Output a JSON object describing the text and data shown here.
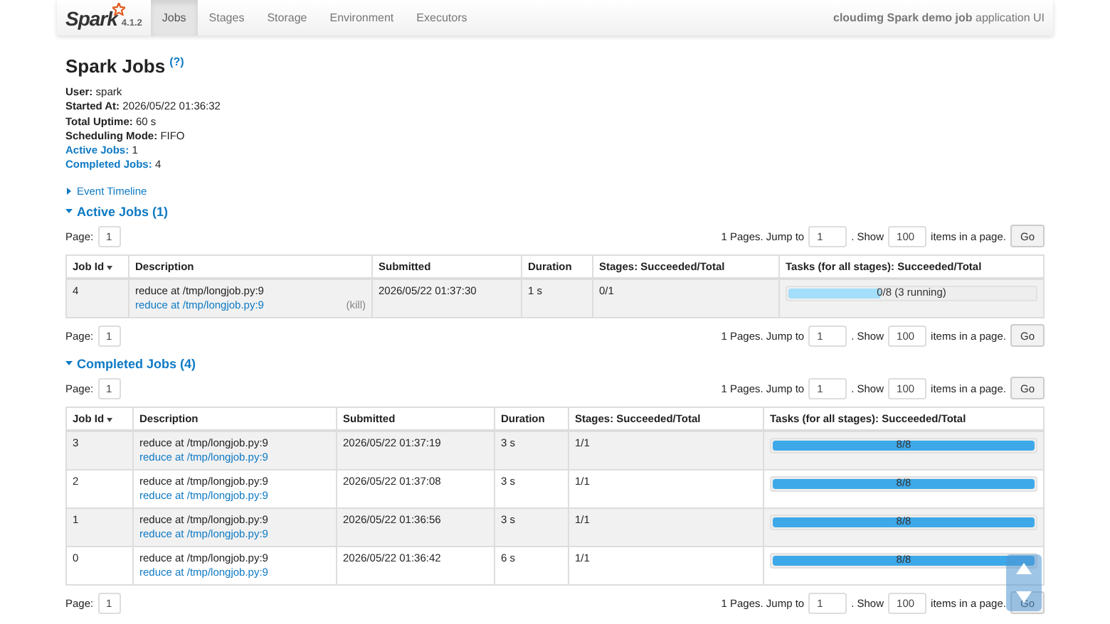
{
  "navbar": {
    "logo_text": "Spark",
    "version": "4.1.2",
    "tabs": [
      {
        "label": "Jobs",
        "selected": true
      },
      {
        "label": "Stages",
        "selected": false
      },
      {
        "label": "Storage",
        "selected": false
      },
      {
        "label": "Environment",
        "selected": false
      },
      {
        "label": "Executors",
        "selected": false
      }
    ],
    "app_title": "**cloudimg Spark demo job** application UI"
  },
  "title": "Spark Jobs",
  "help": "(?)",
  "summary": [
    {
      "label": "User:",
      "value": "spark",
      "link": false
    },
    {
      "label": "Started At:",
      "value": "2026/05/22 01:36:32",
      "link": false
    },
    {
      "label": "Total Uptime:",
      "value": "60 s",
      "link": false
    },
    {
      "label": "Scheduling Mode:",
      "value": "FIFO",
      "link": false
    },
    {
      "label": "Active Jobs:",
      "value": "1",
      "link": true
    },
    {
      "label": "Completed Jobs:",
      "value": "4",
      "link": true
    }
  ],
  "event_timeline": {
    "label": "Event Timeline",
    "expanded": false
  },
  "sections": [
    {
      "title": "Active Jobs (1)",
      "expanded": true,
      "pagers": [
        {
          "page_label": "Page:",
          "page": "1",
          "pages_text": "1 Pages. Jump to",
          "jump": "1",
          "show_label": ". Show",
          "show": "100",
          "items_label": "items in a page.",
          "go": "Go"
        },
        {
          "page_label": "Page:",
          "page": "1",
          "pages_text": "1 Pages. Jump to",
          "jump": "1",
          "show_label": ". Show",
          "show": "100",
          "items_label": "items in a page.",
          "go": "Go"
        }
      ],
      "columns": [
        {
          "label": "Job Id",
          "sorted": true
        },
        {
          "label": "Description",
          "sorted": false
        },
        {
          "label": "Submitted",
          "sorted": false
        },
        {
          "label": "Duration",
          "sorted": false
        },
        {
          "label": "Stages: Succeeded/Total",
          "sorted": false
        },
        {
          "label": "Tasks (for all stages): Succeeded/Total",
          "sorted": false
        }
      ],
      "rows": [
        {
          "id": "4",
          "description": "reduce at /tmp/longjob.py:9",
          "link": "reduce at /tmp/longjob.py:9",
          "kill": "(kill)",
          "submitted": "2026/05/22 01:37:30",
          "duration": "1 s",
          "stages": "0/1",
          "tasks": {
            "kind": "running",
            "level": 0.375,
            "text": "0/8 (3 running)"
          }
        }
      ]
    },
    {
      "title": "Completed Jobs (4)",
      "expanded": true,
      "pagers": [
        {
          "page_label": "Page:",
          "page": "1",
          "pages_text": "1 Pages. Jump to",
          "jump": "1",
          "show_label": ". Show",
          "show": "100",
          "items_label": "items in a page.",
          "go": "Go"
        },
        {
          "page_label": "Page:",
          "page": "1",
          "pages_text": "1 Pages. Jump to",
          "jump": "1",
          "show_label": ". Show",
          "show": "100",
          "items_label": "items in a page.",
          "go": "Go"
        }
      ],
      "columns": [
        {
          "label": "Job Id",
          "sorted": true
        },
        {
          "label": "Description",
          "sorted": false
        },
        {
          "label": "Submitted",
          "sorted": false
        },
        {
          "label": "Duration",
          "sorted": false
        },
        {
          "label": "Stages: Succeeded/Total",
          "sorted": false
        },
        {
          "label": "Tasks (for all stages): Succeeded/Total",
          "sorted": false
        }
      ],
      "rows": [
        {
          "id": "3",
          "description": "reduce at /tmp/longjob.py:9",
          "link": "reduce at /tmp/longjob.py:9",
          "submitted": "2026/05/22 01:37:19",
          "duration": "3 s",
          "stages": "1/1",
          "tasks": {
            "kind": "succeeded",
            "level": 1,
            "text": "8/8"
          }
        },
        {
          "id": "2",
          "description": "reduce at /tmp/longjob.py:9",
          "link": "reduce at /tmp/longjob.py:9",
          "submitted": "2026/05/22 01:37:08",
          "duration": "3 s",
          "stages": "1/1",
          "tasks": {
            "kind": "succeeded",
            "level": 1,
            "text": "8/8"
          }
        },
        {
          "id": "1",
          "description": "reduce at /tmp/longjob.py:9",
          "link": "reduce at /tmp/longjob.py:9",
          "submitted": "2026/05/22 01:36:56",
          "duration": "3 s",
          "stages": "1/1",
          "tasks": {
            "kind": "succeeded",
            "level": 1,
            "text": "8/8"
          }
        },
        {
          "id": "0",
          "description": "reduce at /tmp/longjob.py:9",
          "link": "reduce at /tmp/longjob.py:9",
          "submitted": "2026/05/22 01:36:42",
          "duration": "6 s",
          "stages": "1/1",
          "tasks": {
            "kind": "succeeded",
            "level": 1,
            "text": "8/8"
          }
        }
      ]
    }
  ]
}
